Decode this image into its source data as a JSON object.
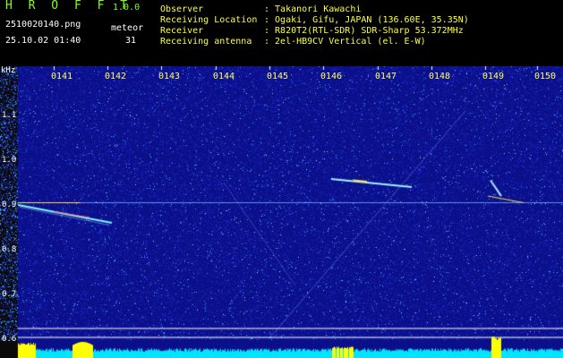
{
  "app": {
    "name": "H R O F F T",
    "version": "1.0.0"
  },
  "info": {
    "filename": "2510020140.png",
    "datetime": "25.10.02 01:40",
    "meteor_label": "meteor",
    "meteor_count": "31"
  },
  "station": [
    {
      "label": "Observer",
      "value": ": Takanori Kawachi"
    },
    {
      "label": "Receiving Location",
      "value": ": Ogaki, Gifu, JAPAN (136.60E, 35.35N)"
    },
    {
      "label": "Receiver",
      "value": ": R820T2(RTL-SDR) SDR-Sharp 53.372MHz"
    },
    {
      "label": "Receiving antenna",
      "value": ": 2el-HB9CV Vertical (el. E-W)"
    }
  ],
  "chart_data": {
    "type": "heatmap",
    "y_unit_label": "kHz",
    "x_ticks": [
      "0141",
      "0142",
      "0143",
      "0144",
      "0145",
      "0146",
      "0147",
      "0148",
      "0149",
      "0150"
    ],
    "y_ticks": [
      "1.1",
      "1.0",
      "0.9",
      "0.8",
      "0.7",
      "0.6"
    ],
    "y_tick_values": [
      1.1,
      1.0,
      0.9,
      0.8,
      0.7,
      0.6
    ],
    "colors": {
      "background": "#0b0f8a",
      "noise": "#3a4cff",
      "signal": "#ffe040",
      "spectrum_fill": "#00e5ff",
      "baseline": "#ffff00"
    }
  }
}
